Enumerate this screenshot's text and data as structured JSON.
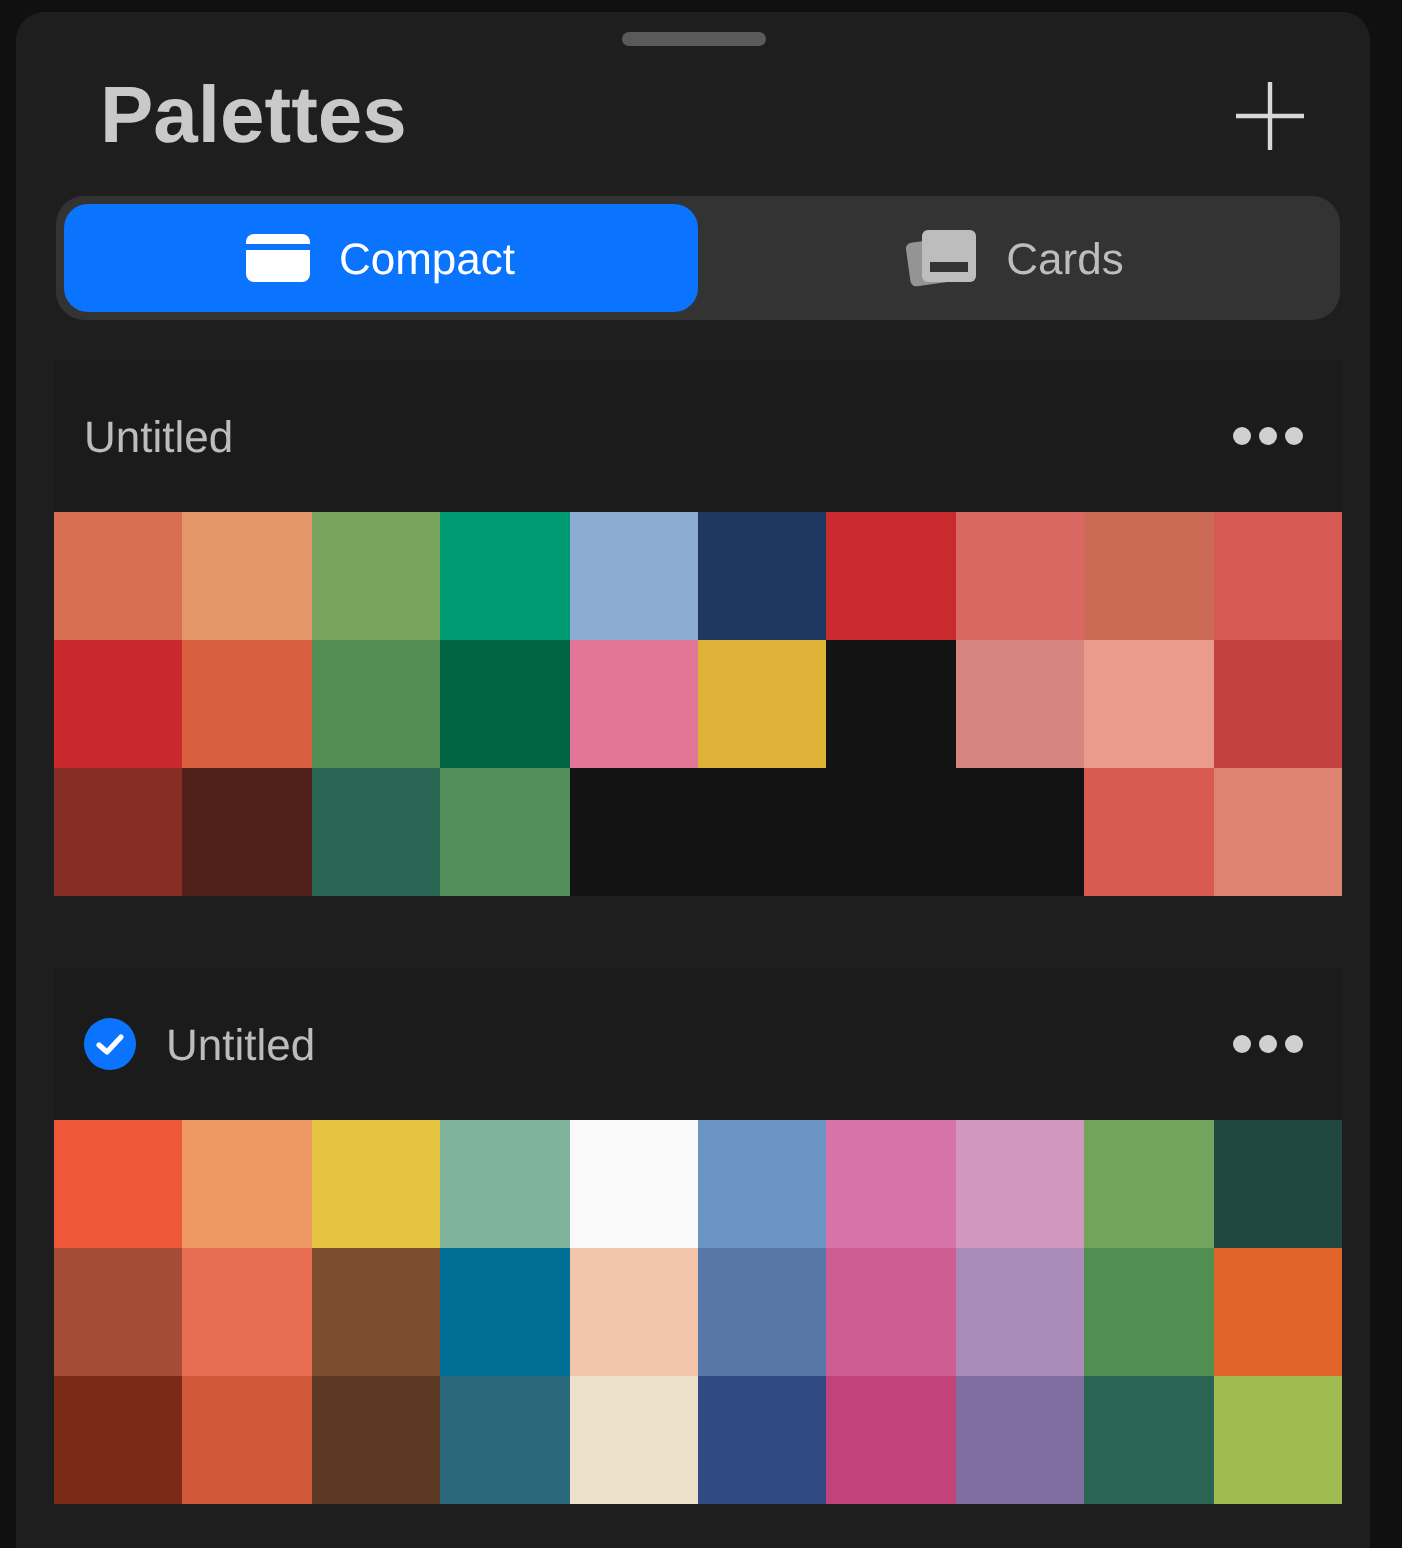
{
  "title": "Palettes",
  "view_tabs": [
    {
      "label": "Compact",
      "selected": true
    },
    {
      "label": "Cards",
      "selected": false
    }
  ],
  "palettes": [
    {
      "name": "Untitled",
      "checked": false,
      "swatches": [
        {
          "color": "#d86f53"
        },
        {
          "color": "#e4956a"
        },
        {
          "color": "#78a45d"
        },
        {
          "color": "#009b72"
        },
        {
          "color": "#8badd3"
        },
        {
          "color": "#1e3861"
        },
        {
          "color": "#c92a2e"
        },
        {
          "color": "#d96762"
        },
        {
          "color": "#cb6a55"
        },
        {
          "color": "#d75a52"
        },
        {
          "color": "#c9292d"
        },
        {
          "color": "#d95f41"
        },
        {
          "color": "#538e55"
        },
        {
          "color": "#006442"
        },
        {
          "color": "#e37696"
        },
        {
          "color": "#deb137"
        },
        {
          "kind": "empty"
        },
        {
          "color": "#d5857d"
        },
        {
          "color": "#e99c8c"
        },
        {
          "color": "#c34141"
        },
        {
          "color": "#862e25"
        },
        {
          "color": "#51201a"
        },
        {
          "color": "#2a6553"
        },
        {
          "color": "#538f5b"
        },
        {
          "kind": "empty"
        },
        {
          "kind": "empty"
        },
        {
          "kind": "empty"
        },
        {
          "kind": "empty"
        },
        {
          "color": "#d85a50"
        },
        {
          "color": "#de8372"
        }
      ]
    },
    {
      "name": "Untitled",
      "checked": true,
      "swatches": [
        {
          "color": "#ee573a"
        },
        {
          "color": "#ec9764"
        },
        {
          "color": "#e6c43f"
        },
        {
          "color": "#80b39b"
        },
        {
          "color": "#f9f9fa"
        },
        {
          "color": "#6b93c4"
        },
        {
          "color": "#d673a7"
        },
        {
          "color": "#d197be"
        },
        {
          "color": "#73a45d"
        },
        {
          "color": "#214840"
        },
        {
          "color": "#a54c37"
        },
        {
          "color": "#e86d53"
        },
        {
          "color": "#7d4d30"
        },
        {
          "color": "#006e94"
        },
        {
          "color": "#f2c5aa"
        },
        {
          "color": "#5777a8"
        },
        {
          "color": "#cd5d92"
        },
        {
          "color": "#ab8bb9"
        },
        {
          "color": "#518f52"
        },
        {
          "color": "#e16429"
        },
        {
          "color": "#7a2a17"
        },
        {
          "color": "#d2583b"
        },
        {
          "color": "#5b3922"
        },
        {
          "color": "#29687a"
        },
        {
          "color": "#ede0ca"
        },
        {
          "color": "#2f4b82"
        },
        {
          "color": "#c1437a"
        },
        {
          "color": "#806ea1"
        },
        {
          "color": "#2a6553"
        },
        {
          "color": "#a0bb50"
        }
      ]
    }
  ]
}
